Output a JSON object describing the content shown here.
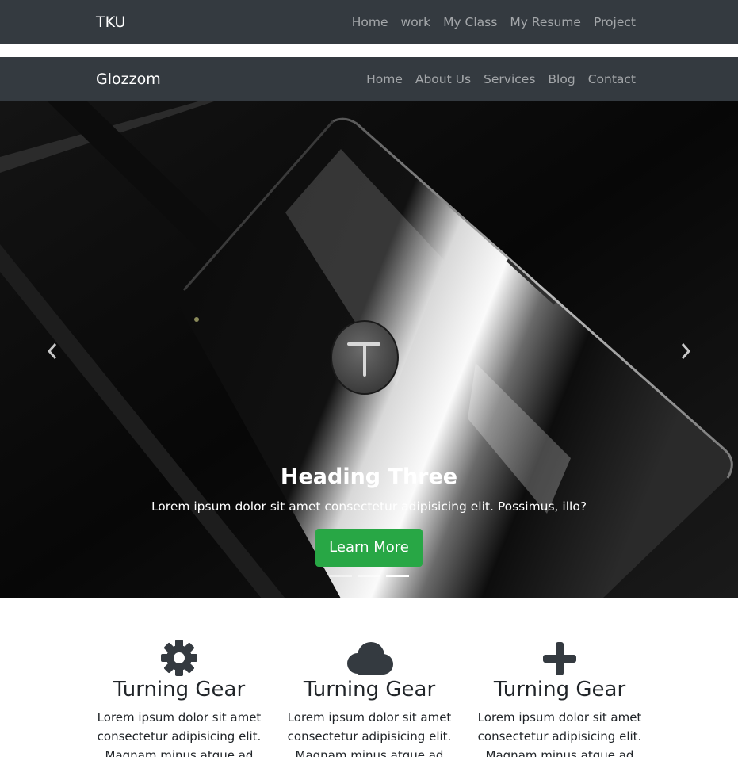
{
  "top_nav": {
    "brand": "TKU",
    "items": [
      "Home",
      "work",
      "My Class",
      "My Resume",
      "Project"
    ]
  },
  "main_nav": {
    "brand": "Glozzom",
    "items": [
      "Home",
      "About Us",
      "Services",
      "Blog",
      "Contact"
    ]
  },
  "carousel": {
    "heading": "Heading Three",
    "text": "Lorem ipsum dolor sit amet consectetur adipisicing elit. Possimus, illo?",
    "button_label": "Learn More",
    "slide_count": 3,
    "active_slide": 3,
    "prev_icon": "chevron-left-icon",
    "next_icon": "chevron-right-icon"
  },
  "features": [
    {
      "icon": "gear-icon",
      "title": "Turning Gear",
      "text": "Lorem ipsum dolor sit amet consectetur adipisicing elit. Magnam minus atque ad"
    },
    {
      "icon": "cloud-icon",
      "title": "Turning Gear",
      "text": "Lorem ipsum dolor sit amet consectetur adipisicing elit. Magnam minus atque ad"
    },
    {
      "icon": "plus-icon",
      "title": "Turning Gear",
      "text": "Lorem ipsum dolor sit amet consectetur adipisicing elit. Magnam minus atque ad"
    }
  ],
  "colors": {
    "navbar_bg": "#343a40",
    "button_green": "#28a745",
    "icon_dark": "#343a40"
  }
}
